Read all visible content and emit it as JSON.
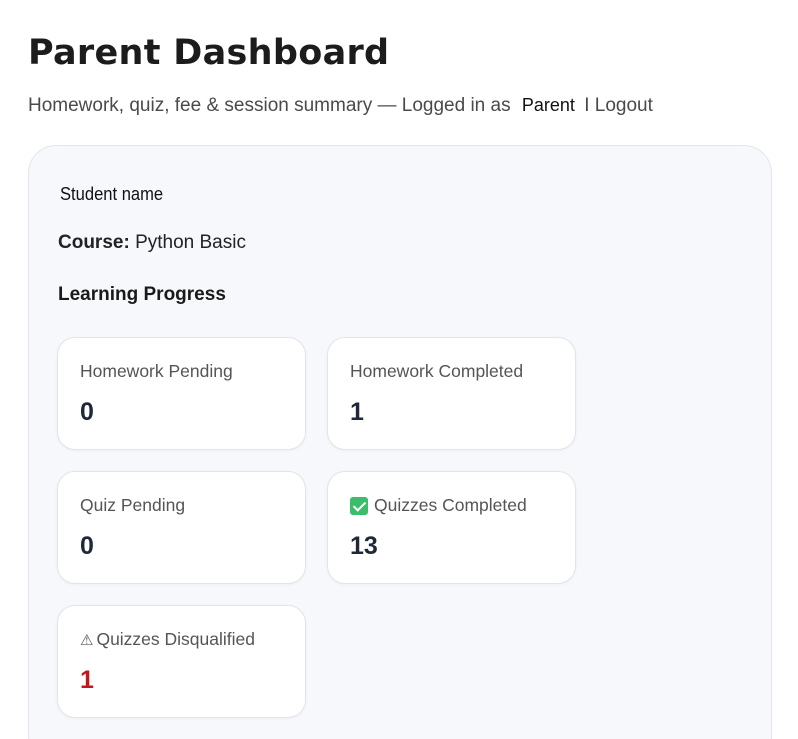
{
  "header": {
    "title": "Parent Dashboard",
    "subtitle_prefix": "Homework, quiz, fee & session summary — Logged in as",
    "role": "Parent",
    "separator": "I",
    "logout_label": "Logout"
  },
  "student": {
    "name": "Student name",
    "course_label": "Course:",
    "course_value": "Python Basic"
  },
  "progress": {
    "heading": "Learning Progress",
    "stats": [
      {
        "label": "Homework Pending",
        "value": "0"
      },
      {
        "label": "Homework Completed",
        "value": "1"
      },
      {
        "label": "Quiz Pending",
        "value": "0"
      },
      {
        "label": "Quizzes Completed",
        "value": "13",
        "icon": "check-mark-icon"
      },
      {
        "label": "Quizzes Disqualified",
        "value": "1",
        "icon": "warning-icon",
        "value_color": "#c4161c"
      }
    ]
  }
}
